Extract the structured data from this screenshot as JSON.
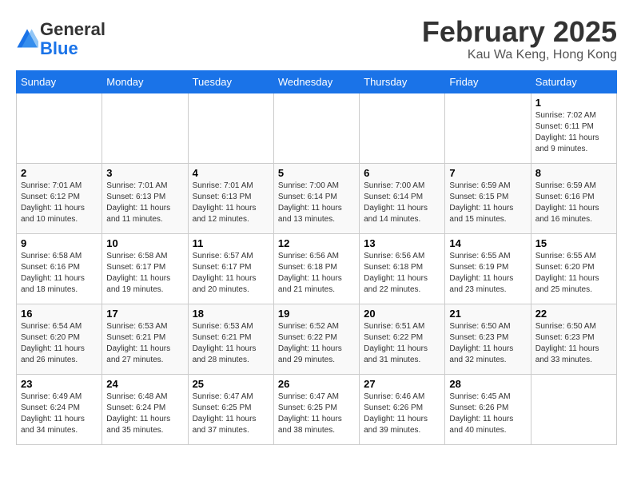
{
  "logo": {
    "line1": "General",
    "line2": "Blue"
  },
  "title": "February 2025",
  "subtitle": "Kau Wa Keng, Hong Kong",
  "weekdays": [
    "Sunday",
    "Monday",
    "Tuesday",
    "Wednesday",
    "Thursday",
    "Friday",
    "Saturday"
  ],
  "weeks": [
    [
      {
        "day": "",
        "info": ""
      },
      {
        "day": "",
        "info": ""
      },
      {
        "day": "",
        "info": ""
      },
      {
        "day": "",
        "info": ""
      },
      {
        "day": "",
        "info": ""
      },
      {
        "day": "",
        "info": ""
      },
      {
        "day": "1",
        "info": "Sunrise: 7:02 AM\nSunset: 6:11 PM\nDaylight: 11 hours and 9 minutes."
      }
    ],
    [
      {
        "day": "2",
        "info": "Sunrise: 7:01 AM\nSunset: 6:12 PM\nDaylight: 11 hours and 10 minutes."
      },
      {
        "day": "3",
        "info": "Sunrise: 7:01 AM\nSunset: 6:13 PM\nDaylight: 11 hours and 11 minutes."
      },
      {
        "day": "4",
        "info": "Sunrise: 7:01 AM\nSunset: 6:13 PM\nDaylight: 11 hours and 12 minutes."
      },
      {
        "day": "5",
        "info": "Sunrise: 7:00 AM\nSunset: 6:14 PM\nDaylight: 11 hours and 13 minutes."
      },
      {
        "day": "6",
        "info": "Sunrise: 7:00 AM\nSunset: 6:14 PM\nDaylight: 11 hours and 14 minutes."
      },
      {
        "day": "7",
        "info": "Sunrise: 6:59 AM\nSunset: 6:15 PM\nDaylight: 11 hours and 15 minutes."
      },
      {
        "day": "8",
        "info": "Sunrise: 6:59 AM\nSunset: 6:16 PM\nDaylight: 11 hours and 16 minutes."
      }
    ],
    [
      {
        "day": "9",
        "info": "Sunrise: 6:58 AM\nSunset: 6:16 PM\nDaylight: 11 hours and 18 minutes."
      },
      {
        "day": "10",
        "info": "Sunrise: 6:58 AM\nSunset: 6:17 PM\nDaylight: 11 hours and 19 minutes."
      },
      {
        "day": "11",
        "info": "Sunrise: 6:57 AM\nSunset: 6:17 PM\nDaylight: 11 hours and 20 minutes."
      },
      {
        "day": "12",
        "info": "Sunrise: 6:56 AM\nSunset: 6:18 PM\nDaylight: 11 hours and 21 minutes."
      },
      {
        "day": "13",
        "info": "Sunrise: 6:56 AM\nSunset: 6:18 PM\nDaylight: 11 hours and 22 minutes."
      },
      {
        "day": "14",
        "info": "Sunrise: 6:55 AM\nSunset: 6:19 PM\nDaylight: 11 hours and 23 minutes."
      },
      {
        "day": "15",
        "info": "Sunrise: 6:55 AM\nSunset: 6:20 PM\nDaylight: 11 hours and 25 minutes."
      }
    ],
    [
      {
        "day": "16",
        "info": "Sunrise: 6:54 AM\nSunset: 6:20 PM\nDaylight: 11 hours and 26 minutes."
      },
      {
        "day": "17",
        "info": "Sunrise: 6:53 AM\nSunset: 6:21 PM\nDaylight: 11 hours and 27 minutes."
      },
      {
        "day": "18",
        "info": "Sunrise: 6:53 AM\nSunset: 6:21 PM\nDaylight: 11 hours and 28 minutes."
      },
      {
        "day": "19",
        "info": "Sunrise: 6:52 AM\nSunset: 6:22 PM\nDaylight: 11 hours and 29 minutes."
      },
      {
        "day": "20",
        "info": "Sunrise: 6:51 AM\nSunset: 6:22 PM\nDaylight: 11 hours and 31 minutes."
      },
      {
        "day": "21",
        "info": "Sunrise: 6:50 AM\nSunset: 6:23 PM\nDaylight: 11 hours and 32 minutes."
      },
      {
        "day": "22",
        "info": "Sunrise: 6:50 AM\nSunset: 6:23 PM\nDaylight: 11 hours and 33 minutes."
      }
    ],
    [
      {
        "day": "23",
        "info": "Sunrise: 6:49 AM\nSunset: 6:24 PM\nDaylight: 11 hours and 34 minutes."
      },
      {
        "day": "24",
        "info": "Sunrise: 6:48 AM\nSunset: 6:24 PM\nDaylight: 11 hours and 35 minutes."
      },
      {
        "day": "25",
        "info": "Sunrise: 6:47 AM\nSunset: 6:25 PM\nDaylight: 11 hours and 37 minutes."
      },
      {
        "day": "26",
        "info": "Sunrise: 6:47 AM\nSunset: 6:25 PM\nDaylight: 11 hours and 38 minutes."
      },
      {
        "day": "27",
        "info": "Sunrise: 6:46 AM\nSunset: 6:26 PM\nDaylight: 11 hours and 39 minutes."
      },
      {
        "day": "28",
        "info": "Sunrise: 6:45 AM\nSunset: 6:26 PM\nDaylight: 11 hours and 40 minutes."
      },
      {
        "day": "",
        "info": ""
      }
    ]
  ]
}
